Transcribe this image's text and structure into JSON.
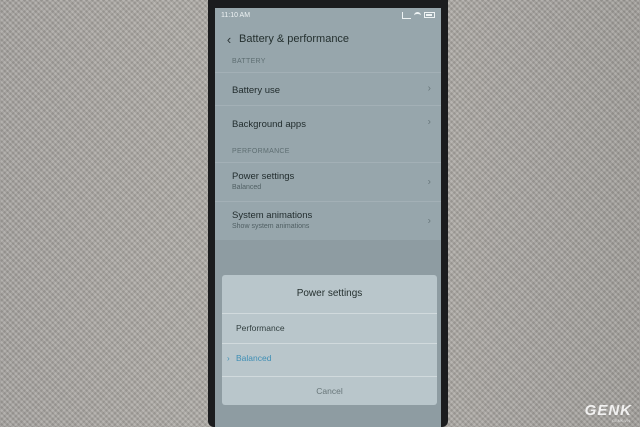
{
  "status": {
    "time": "11:10 AM"
  },
  "header": {
    "title": "Battery & performance"
  },
  "sections": {
    "battery": "BATTERY",
    "performance": "PERFORMANCE"
  },
  "rows": {
    "battery_use": "Battery use",
    "background_apps": "Background apps",
    "power_settings": {
      "label": "Power settings",
      "sub": "Balanced"
    },
    "system_animations": {
      "label": "System animations",
      "sub": "Show system animations"
    }
  },
  "dialog": {
    "title": "Power settings",
    "options": [
      "Performance",
      "Balanced"
    ],
    "selected": "Balanced",
    "cancel": "Cancel"
  },
  "watermark": {
    "brand": "GENK",
    "sub": "GENK.VN"
  },
  "colors": {
    "accent": "#3f8fb5",
    "screen_bg": "#97a6ac",
    "dialog_bg": "#b9c6cb"
  }
}
